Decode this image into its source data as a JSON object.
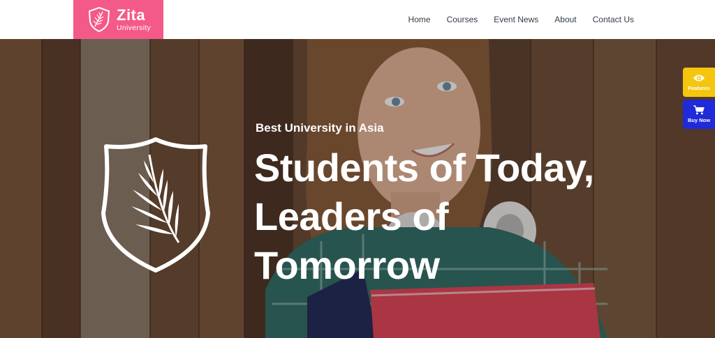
{
  "brand": {
    "name": "Zita",
    "subtitle": "University",
    "color": "#f45a87"
  },
  "nav": {
    "items": [
      {
        "label": "Home"
      },
      {
        "label": "Courses"
      },
      {
        "label": "Event News"
      },
      {
        "label": "About"
      },
      {
        "label": "Contact Us"
      }
    ]
  },
  "hero": {
    "kicker": "Best University in Asia",
    "headline_line1": "Students of Today,",
    "headline_line2": "Leaders of",
    "headline_line3": "Tomorrow",
    "crest_icon": "shield-leaf-icon"
  },
  "side_widgets": {
    "features_label": "Features",
    "features_color": "#f5c60f",
    "features_icon": "eye-icon",
    "buy_label": "Buy Now",
    "buy_color": "#1f2ad8",
    "buy_icon": "cart-icon"
  }
}
